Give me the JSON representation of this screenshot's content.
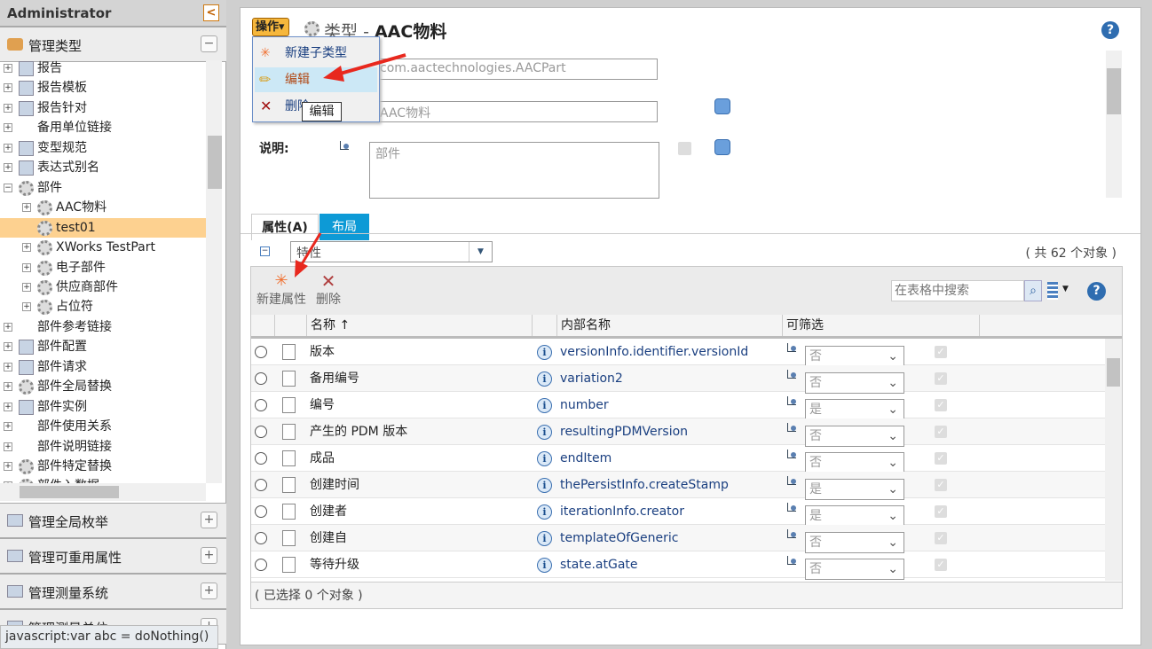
{
  "sidebar": {
    "title": "Administrator",
    "section_open": "管理类型",
    "tree": [
      {
        "label": "报告",
        "level": 0,
        "exp": "+",
        "icon": "report-chart-icon"
      },
      {
        "label": "报告模板",
        "level": 0,
        "exp": "+",
        "icon": "report-template-icon"
      },
      {
        "label": "报告针对",
        "level": 0,
        "exp": "+",
        "icon": "report-link-icon"
      },
      {
        "label": "备用单位链接",
        "level": 0,
        "exp": "+",
        "icon": ""
      },
      {
        "label": "变型规范",
        "level": 0,
        "exp": "+",
        "icon": "spec-icon"
      },
      {
        "label": "表达式别名",
        "level": 0,
        "exp": "+",
        "icon": "alias-icon"
      },
      {
        "label": "部件",
        "level": 0,
        "exp": "-",
        "icon": "gear-icon"
      },
      {
        "label": "AAC物料",
        "level": 1,
        "exp": "+",
        "icon": "gear-icon"
      },
      {
        "label": "test01",
        "level": 1,
        "exp": "",
        "icon": "gear-icon",
        "selected": true
      },
      {
        "label": "XWorks TestPart",
        "level": 1,
        "exp": "+",
        "icon": "gear-icon"
      },
      {
        "label": "电子部件",
        "level": 1,
        "exp": "+",
        "icon": "gear-icon"
      },
      {
        "label": "供应商部件",
        "level": 1,
        "exp": "+",
        "icon": "gear-icon"
      },
      {
        "label": "占位符",
        "level": 1,
        "exp": "+",
        "icon": "gear-icon"
      },
      {
        "label": "部件参考链接",
        "level": 0,
        "exp": "+",
        "icon": ""
      },
      {
        "label": "部件配置",
        "level": 0,
        "exp": "+",
        "icon": "config-icon"
      },
      {
        "label": "部件请求",
        "level": 0,
        "exp": "+",
        "icon": "request-icon"
      },
      {
        "label": "部件全局替换",
        "level": 0,
        "exp": "+",
        "icon": "gear-icon"
      },
      {
        "label": "部件实例",
        "level": 0,
        "exp": "+",
        "icon": "instance-icon"
      },
      {
        "label": "部件使用关系",
        "level": 0,
        "exp": "+",
        "icon": ""
      },
      {
        "label": "部件说明链接",
        "level": 0,
        "exp": "+",
        "icon": ""
      },
      {
        "label": "部件特定替换",
        "level": 0,
        "exp": "+",
        "icon": "gear-icon"
      },
      {
        "label": "部件入数据",
        "level": 0,
        "exp": "+",
        "icon": "gear-icon"
      }
    ],
    "sections": [
      "管理全局枚举",
      "管理可重用属性",
      "管理测量系统",
      "管理测量单位"
    ],
    "status": "javascript:var abc = doNothing()"
  },
  "header": {
    "actions_label": "操作",
    "type_label": "类型",
    "separator": "-",
    "title": "AAC物料"
  },
  "menu": {
    "items": [
      "新建子类型",
      "编辑",
      "删除"
    ],
    "tooltip": "编辑"
  },
  "form": {
    "internal_name": "com.aactechnologies.AACPart",
    "display_name": "AAC物料",
    "desc_label": "说明:",
    "desc_value": "部件"
  },
  "tabs": [
    "属性(A)",
    "布局"
  ],
  "filter": {
    "value": "特性",
    "count": "( 共 62 个对象 )"
  },
  "toolbar": {
    "new_attr": "新建属性",
    "delete": "删除",
    "search_placeholder": "在表格中搜索"
  },
  "table": {
    "columns": [
      "名称",
      "内部名称",
      "可筛选"
    ],
    "sort_indicator": "↑",
    "rows": [
      {
        "name": "版本",
        "internal": "versionInfo.identifier.versionId",
        "filter": "否",
        "icon": "document-icon"
      },
      {
        "name": "备用编号",
        "internal": "variation2",
        "filter": "否",
        "icon": "document-icon"
      },
      {
        "name": "编号",
        "internal": "number",
        "filter": "是",
        "icon": "document-icon"
      },
      {
        "name": "产生的 PDM 版本",
        "internal": "resultingPDMVersion",
        "filter": "否",
        "icon": "document-icon"
      },
      {
        "name": "成品",
        "internal": "endItem",
        "filter": "否",
        "icon": "boolean-icon"
      },
      {
        "name": "创建时间",
        "internal": "thePersistInfo.createStamp",
        "filter": "是",
        "icon": "calendar-icon"
      },
      {
        "name": "创建者",
        "internal": "iterationInfo.creator",
        "filter": "是",
        "icon": "reference-icon"
      },
      {
        "name": "创建自",
        "internal": "templateOfGeneric",
        "filter": "否",
        "icon": "document-icon"
      },
      {
        "name": "等待升级",
        "internal": "state.atGate",
        "filter": "否",
        "icon": "boolean-icon"
      }
    ],
    "footer": "( 已选择 0 个对象 )"
  },
  "colors": {
    "selected_row": "#fdd190",
    "tab_active": "#0d9ad6",
    "menu_highlight": "#cce8f6",
    "arrow": "#e8281e"
  }
}
